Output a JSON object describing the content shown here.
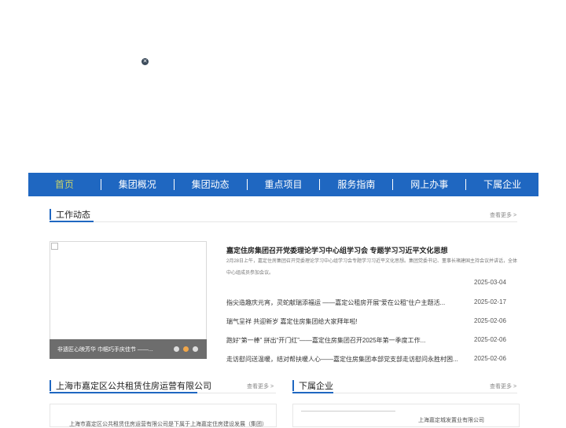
{
  "nav": {
    "items": [
      "首页",
      "集团概况",
      "集团动态",
      "重点项目",
      "服务指南",
      "网上办事",
      "下属企业"
    ]
  },
  "work": {
    "title": "工作动态",
    "more": "查看更多 >",
    "slide_caption": "非遗匠心映芳华 巾帼巧手庆佳节 ——...",
    "headline": "嘉定住房集团召开党委理论学习中心组学习会 专题学习习近平文化思想",
    "summary": "2月28日上午，嘉定住房集团召开党委理论学习中心组学习会专题学习习近平文化思想。集团党委书记、董事长褚建国主持会议并讲话，全体中心组成员参加会议。",
    "headline_date": "2025-03-04",
    "news": [
      {
        "title": "指尖造趣庆元宵，灵蛇献瑞添福运 ——嘉定公租房开展“爱在公租”住户主题活...",
        "date": "2025-02-17"
      },
      {
        "title": "瑞气呈祥 共迎新岁 嘉定住房集团给大家拜年啦!",
        "date": "2025-02-06"
      },
      {
        "title": "跑好“第一棒” 拼出“开门红”——嘉定住房集团召开2025年第一季度工作...",
        "date": "2025-02-06"
      },
      {
        "title": "走访慰问送温暖，结对帮扶暖人心——嘉定住房集团本部党支部走访慰问永胜村困...",
        "date": "2025-02-06"
      }
    ]
  },
  "company": {
    "title": "上海市嘉定区公共租赁住房运营有限公司",
    "more": "查看更多 >",
    "intro": "上海市嘉定区公共租赁住房运营有限公司是下属于上海嘉定住房建设发展（集团）"
  },
  "subsidiary": {
    "title": "下属企业",
    "more": "查看更多 >",
    "first": "上海嘉定城发置业有限公司"
  },
  "colors": {
    "nav_bg": "#1f67c1",
    "active": "#c8d36a",
    "dot_active": "#f0a64a"
  }
}
